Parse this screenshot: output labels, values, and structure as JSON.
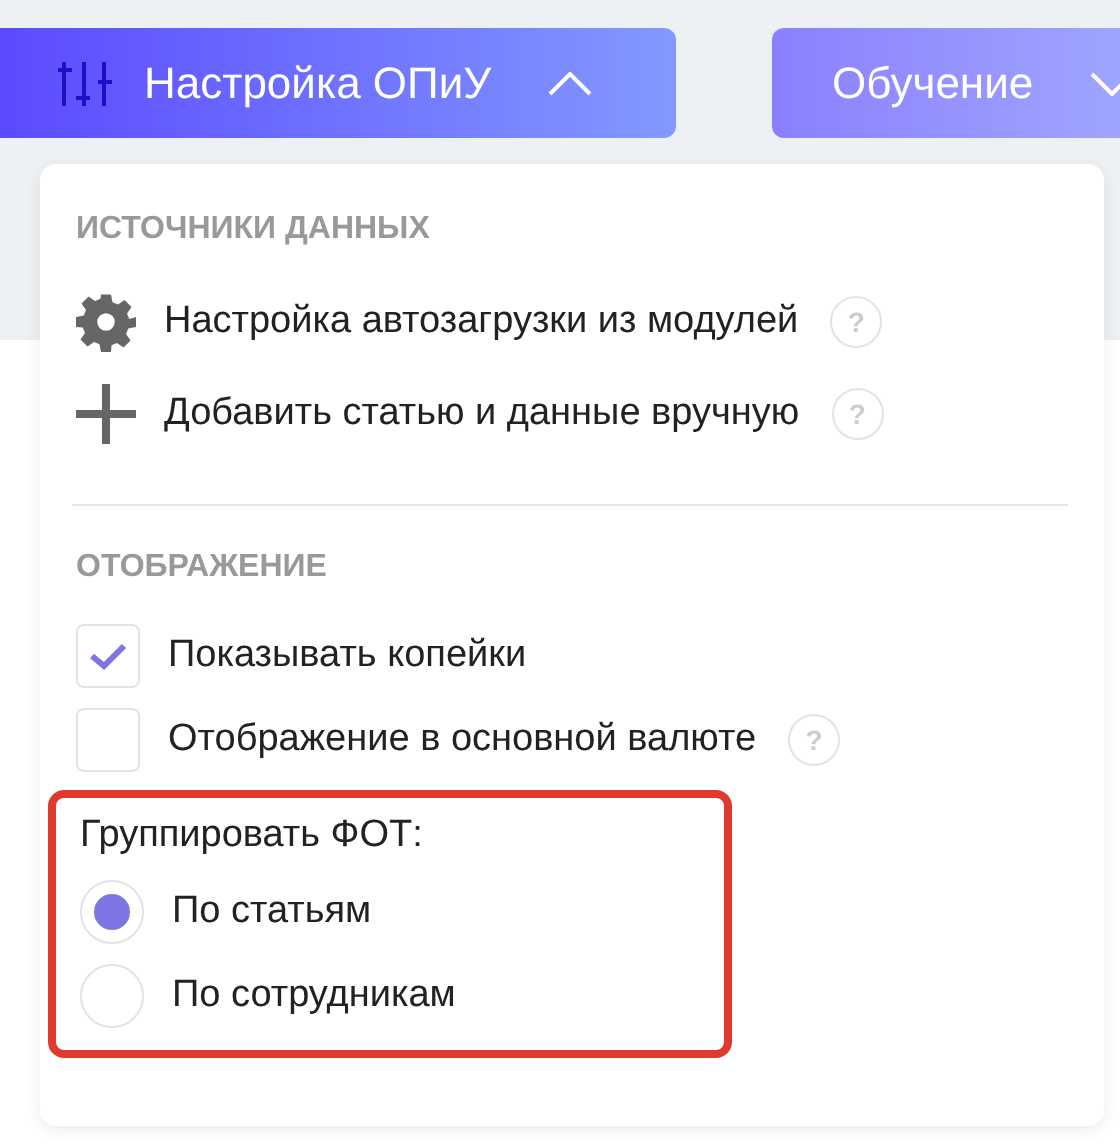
{
  "toolbar": [
    {
      "label": "Настройка ОПиУ",
      "expanded": true,
      "kind": "primary"
    },
    {
      "label": "Обучение",
      "expanded": false,
      "kind": "secondary"
    }
  ],
  "menu": {
    "sources": {
      "heading": "ИСТОЧНИКИ ДАННЫХ",
      "items": [
        {
          "label": "Настройка автозагрузки из модулей",
          "help": "?"
        },
        {
          "label": "Добавить статью и данные вручную",
          "help": "?"
        }
      ]
    },
    "display": {
      "heading": "ОТОБРАЖЕНИЕ",
      "options": [
        {
          "label": "Показывать копейки",
          "checked": true
        },
        {
          "label": "Отображение в основной валюте",
          "checked": false,
          "help": "?"
        }
      ]
    },
    "grouping": {
      "label": "Группировать ФОТ:",
      "highlighted": true,
      "options": [
        {
          "label": "По статьям",
          "selected": true
        },
        {
          "label": "По сотрудникам",
          "selected": false
        }
      ]
    }
  }
}
